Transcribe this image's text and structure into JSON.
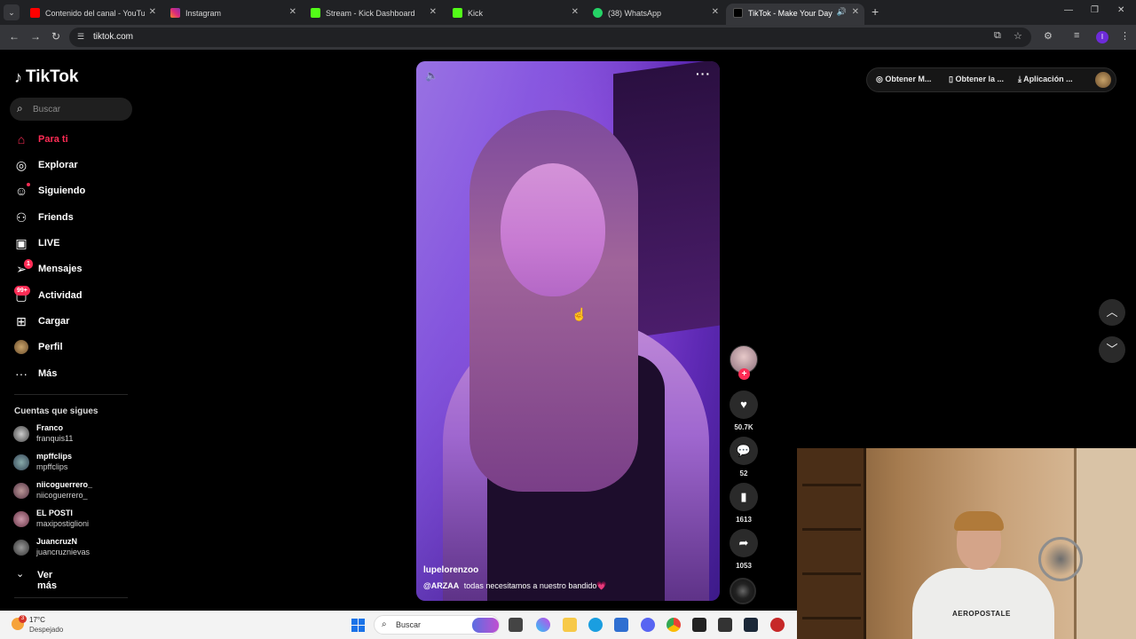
{
  "browser": {
    "tabs": [
      {
        "title": "Contenido del canal - YouTube",
        "color": "#ff0000"
      },
      {
        "title": "Instagram",
        "color": "#d62976"
      },
      {
        "title": "Stream - Kick Dashboard",
        "color": "#53fc18"
      },
      {
        "title": "Kick",
        "color": "#53fc18"
      },
      {
        "title": "(38) WhatsApp",
        "color": "#25d366"
      },
      {
        "title": "TikTok - Make Your Day",
        "color": "#000000"
      }
    ],
    "url": "tiktok.com",
    "profile_initial": "I"
  },
  "sidebar": {
    "logo": "TikTok",
    "search_placeholder": "Buscar",
    "nav": [
      {
        "label": "Para ti",
        "icon": "home-icon"
      },
      {
        "label": "Explorar",
        "icon": "compass-icon"
      },
      {
        "label": "Siguiendo",
        "icon": "following-icon"
      },
      {
        "label": "Friends",
        "icon": "friends-icon"
      },
      {
        "label": "LIVE",
        "icon": "live-icon"
      },
      {
        "label": "Mensajes",
        "icon": "send-icon",
        "badge": "1"
      },
      {
        "label": "Actividad",
        "icon": "activity-icon",
        "badge": "99+"
      },
      {
        "label": "Cargar",
        "icon": "upload-icon"
      },
      {
        "label": "Perfil",
        "icon": "profile-avatar"
      },
      {
        "label": "Más",
        "icon": "more-icon"
      }
    ],
    "following_header": "Cuentas que sigues",
    "following": [
      {
        "name": "Franco",
        "handle": "franquis11"
      },
      {
        "name": "mpffclips",
        "handle": "mpffclips"
      },
      {
        "name": "niicoguerrero_",
        "handle": "niicoguerrero_"
      },
      {
        "name": "EL POSTI",
        "handle": "maxipostiglioni"
      },
      {
        "name": "JuancruzN",
        "handle": "juancruznievas"
      }
    ],
    "see_more": "Ver más"
  },
  "top_buttons": {
    "obtener_m": "Obtener M...",
    "obtener_la": "Obtener la ...",
    "aplicacion": "Aplicación ..."
  },
  "video": {
    "author": "lupelorenzoo",
    "mention": "@ARZAA",
    "caption": "todas necesitamos a nuestro bandido💗",
    "likes": "50.7K",
    "comments": "52",
    "saves": "1613",
    "shares": "1053"
  },
  "webcam": {
    "shirt_text": "AEROPOSTALE"
  },
  "taskbar": {
    "temperature": "17°C",
    "condition": "Despejado",
    "weather_badge": "3",
    "search_placeholder": "Buscar"
  }
}
